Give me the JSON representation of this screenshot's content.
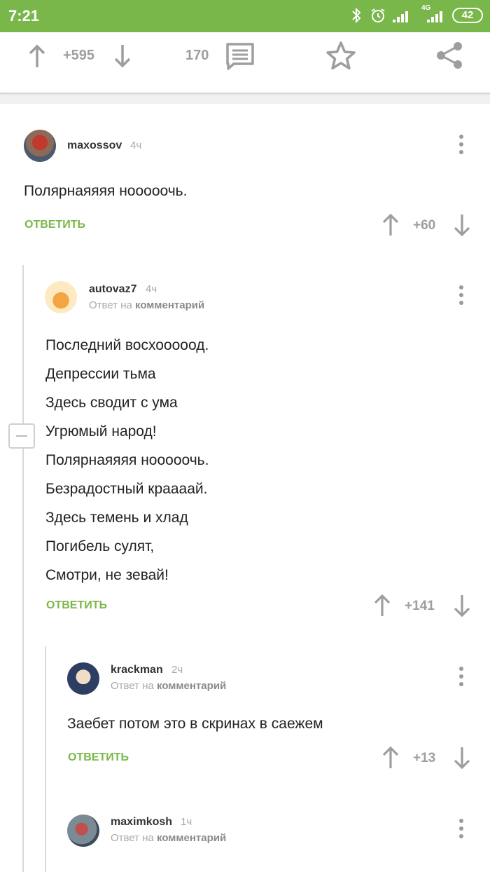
{
  "status_bar": {
    "time": "7:21",
    "network": "4G",
    "battery": "42",
    "icons": [
      "bluetooth-icon",
      "alarm-icon",
      "signal-icon",
      "signal-4g-icon",
      "battery-icon"
    ]
  },
  "post_bar": {
    "rating": "+595",
    "comments_count": "170",
    "icons": [
      "upvote-arrow-icon",
      "downvote-arrow-icon",
      "comments-icon",
      "star-icon",
      "share-icon"
    ]
  },
  "comments": [
    {
      "author": "maxossov",
      "time": "4ч",
      "reply_prefix": "",
      "reply_target": "",
      "lines": [
        "Полярнаяяяя нооооочь."
      ],
      "reply_label": "ОТВЕТИТЬ",
      "score": "+60"
    },
    {
      "author": "autovaz7",
      "time": "4ч",
      "reply_prefix": "Ответ на",
      "reply_target": "комментарий",
      "lines": [
        "Последний восхооооод.",
        "Депрессии тьма",
        "Здесь сводит с ума",
        "Угрюмый народ!",
        "Полярнаяяяя нооооочь.",
        "Безрадостный краааай.",
        "Здесь темень и хлад",
        "Погибель сулят,",
        "Смотри, не зевай!"
      ],
      "reply_label": "ОТВЕТИТЬ",
      "score": "+141"
    },
    {
      "author": "krackman",
      "time": "2ч",
      "reply_prefix": "Ответ на",
      "reply_target": "комментарий",
      "lines": [
        "Заебет потом это в скринах в саежем"
      ],
      "reply_label": "ОТВЕТИТЬ",
      "score": "+13"
    },
    {
      "author": "maximkosh",
      "time": "1ч",
      "reply_prefix": "Ответ на",
      "reply_target": "комментарий",
      "lines": [],
      "reply_label": "",
      "score": ""
    }
  ],
  "colors": {
    "accent": "#7ab74a",
    "muted": "#9e9e9e",
    "thread_line": "#d9d9d9"
  }
}
